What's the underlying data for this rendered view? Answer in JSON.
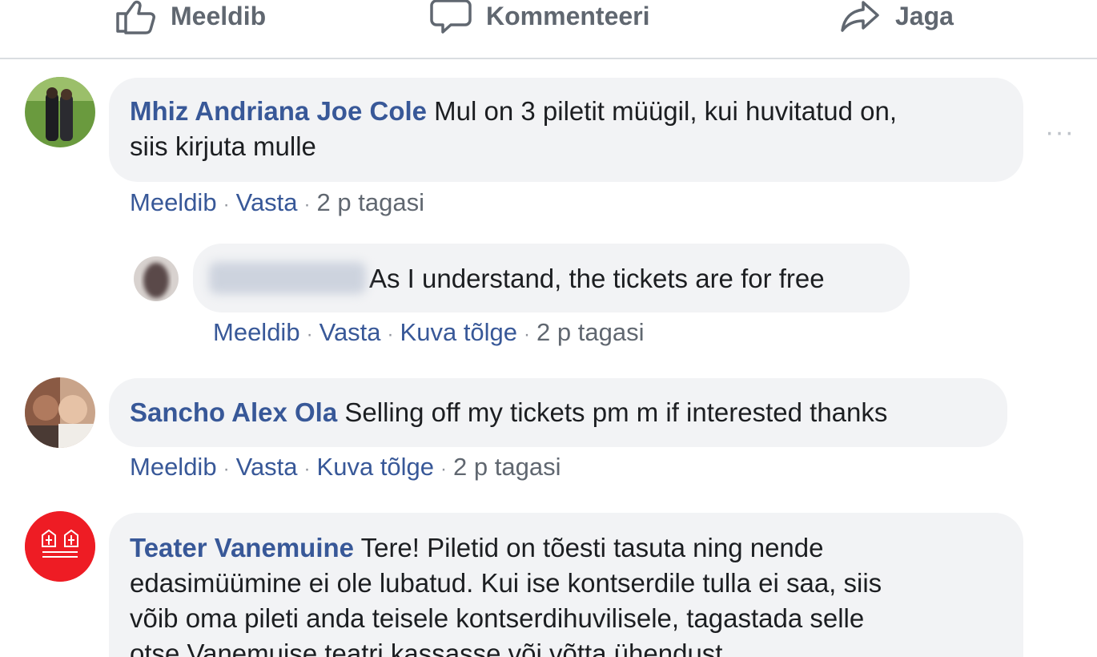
{
  "actions": {
    "like": "Meeldib",
    "comment": "Kommenteeri",
    "share": "Jaga"
  },
  "comments": [
    {
      "author": "Mhiz Andriana Joe Cole",
      "text_line1": "Mul on 3 piletit müügil, kui huvitatud on,",
      "text_line2": "siis kirjuta mulle",
      "like": "Meeldib",
      "reply": "Vasta",
      "time": "2 p tagasi",
      "more": "···",
      "replies": [
        {
          "text": "As I understand, the tickets are for free",
          "like": "Meeldib",
          "reply": "Vasta",
          "translate": "Kuva tõlge",
          "time": "2 p tagasi"
        }
      ]
    },
    {
      "author": "Sancho Alex Ola",
      "text": "Selling off my tickets pm m if interested thanks",
      "like": "Meeldib",
      "reply": "Vasta",
      "translate": "Kuva tõlge",
      "time": "2 p tagasi"
    },
    {
      "author": "Teater Vanemuine",
      "text_line1": "Tere! Piletid on tõesti tasuta ning nende",
      "text_line2": "edasimüümine ei ole lubatud. Kui ise kontserdile tulla ei saa, siis",
      "text_line3": "võib oma pileti anda teisele kontserdihuvilisele, tagastada selle",
      "text_line4": "otse Vanemuise teatri kassasse või võtta ühendust"
    }
  ],
  "colors": {
    "link": "#385898",
    "muted": "#606770",
    "bubble": "#f2f3f5",
    "divider": "#dadde1",
    "vanemuine_red": "#ee1c24"
  }
}
